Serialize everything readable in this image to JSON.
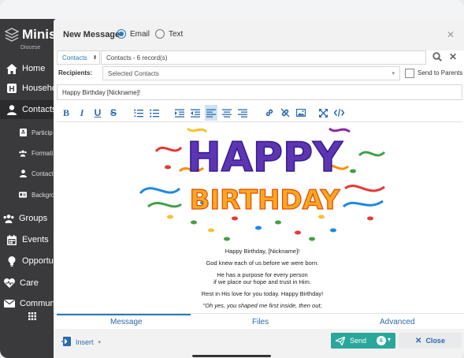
{
  "sidebar": {
    "brand": "Minis",
    "brand_sub": "Diocese",
    "items": [
      {
        "label": "Home",
        "icon": "home-icon"
      },
      {
        "label": "Househo",
        "icon": "household-icon"
      },
      {
        "label": "Contacts",
        "icon": "person-icon"
      },
      {
        "label": "Particip",
        "icon": "badge-icon"
      },
      {
        "label": "Formati",
        "icon": "group-icon"
      },
      {
        "label": "Contact",
        "icon": "person-icon"
      },
      {
        "label": "Backgro",
        "icon": "idcard-icon"
      },
      {
        "label": "Groups",
        "icon": "groups-icon"
      },
      {
        "label": "Events",
        "icon": "calendar-icon"
      },
      {
        "label": "Opportun",
        "icon": "lightbulb-icon"
      },
      {
        "label": "Care",
        "icon": "heart-icon"
      },
      {
        "label": "Commun",
        "icon": "mail-icon"
      }
    ]
  },
  "modal": {
    "title": "New Message",
    "mode_email": "Email",
    "mode_text": "Text",
    "contacts_select": "Contacts",
    "contacts_value": "Contacts - 6 record(s)",
    "recipients_label": "Recipients:",
    "recipients_value": "Selected Contacts",
    "send_to_parents": "Send to Parents",
    "subject": "Happy Birthday [Nickname]!",
    "banner_word1": "HAPPY",
    "banner_word2": "BIRTHDAY",
    "body_lines": [
      "Happy Birthday, [Nickname]!",
      "God knew each of us before we were born.",
      "He has a purpose for every person",
      "if we place our hope and trust in Him.",
      "Rest in His love for you today. Happy Birthday!",
      "\"Oh yes, you shaped me first inside, then out;"
    ],
    "tabs": [
      "Message",
      "Files",
      "Advanced"
    ],
    "insert_label": "Insert",
    "send_label": "Send",
    "send_count": "6",
    "close_label": "Close"
  },
  "colors": {
    "accent": "#2a7ab8",
    "send": "#2aa79b",
    "sidebar": "#3a3a3c"
  }
}
